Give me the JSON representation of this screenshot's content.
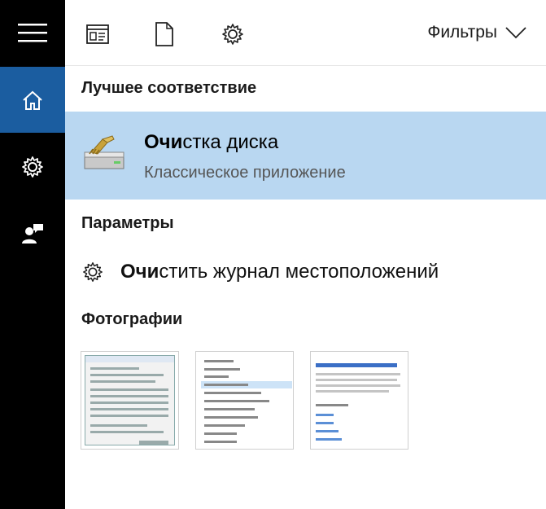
{
  "sidebar": {
    "items": [
      {
        "icon": "hamburger-icon"
      },
      {
        "icon": "home-icon",
        "active": true
      },
      {
        "icon": "gear-icon"
      },
      {
        "icon": "user-feedback-icon"
      }
    ]
  },
  "toolbar": {
    "icons": [
      "app-list-icon",
      "document-icon",
      "settings-gear-icon"
    ],
    "filters_label": "Фильтры"
  },
  "best_match": {
    "heading": "Лучшее соответствие",
    "title_bold": "Очи",
    "title_rest": "стка диска",
    "subtitle": "Классическое приложение",
    "highlight_color": "#b9d7f1"
  },
  "settings": {
    "heading": "Параметры",
    "item_bold": "Очи",
    "item_rest": "стить журнал местоположений"
  },
  "photos": {
    "heading": "Фотографии"
  },
  "colors": {
    "sidebar_bg": "#000000",
    "sidebar_active": "#1b5da0"
  }
}
